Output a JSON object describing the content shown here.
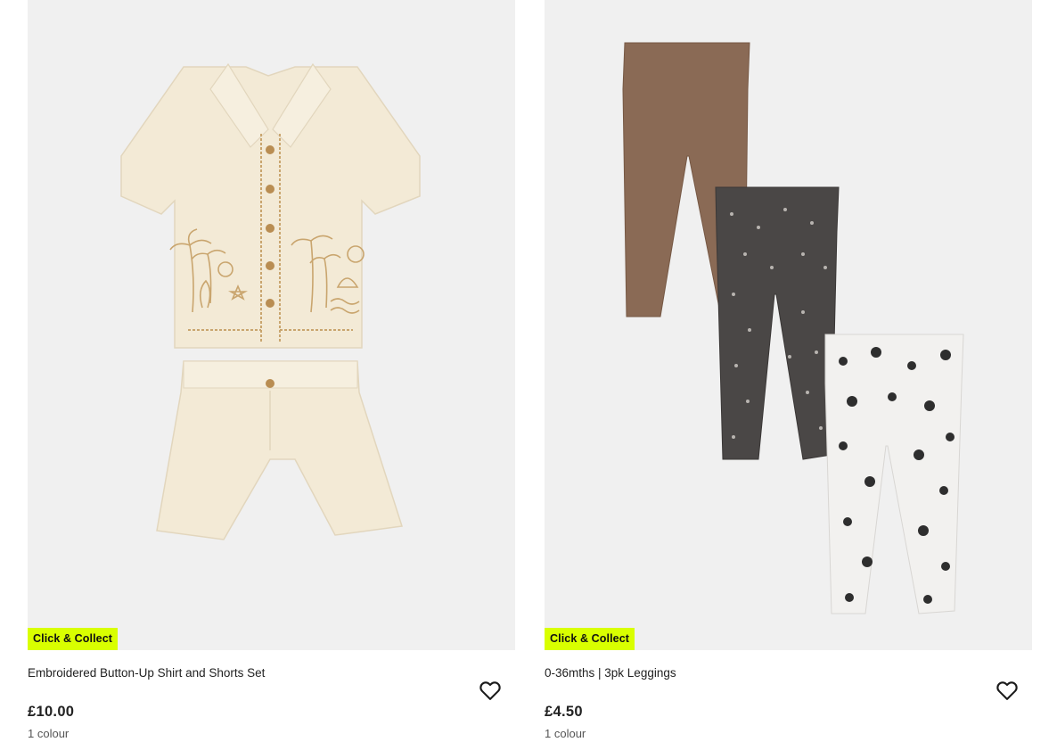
{
  "products": [
    {
      "badge": "Click & Collect",
      "title": "Embroidered Button-Up Shirt and Shorts Set",
      "price": "£10.00",
      "colours": "1 colour",
      "wishlist_icon": "heart-outline-icon"
    },
    {
      "badge": "Click & Collect",
      "title": "0-36mths | 3pk Leggings",
      "price": "£4.50",
      "colours": "1 colour",
      "wishlist_icon": "heart-outline-icon"
    }
  ],
  "colors": {
    "badge_bg": "#d9ff00",
    "image_bg": "#f0f0f0",
    "text": "#222222"
  }
}
